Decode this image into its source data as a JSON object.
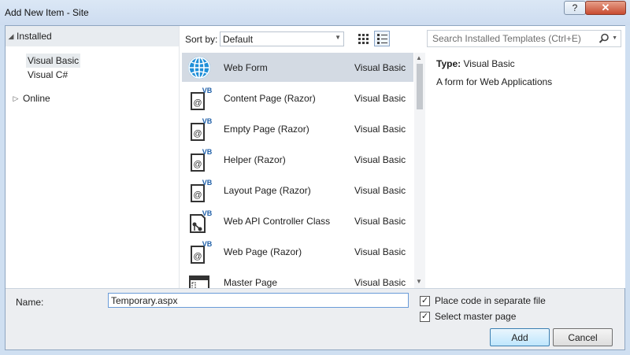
{
  "window": {
    "title": "Add New Item - Site",
    "help_glyph": "?",
    "close_glyph": "✕"
  },
  "tree": {
    "installed_label": "Installed",
    "children": [
      {
        "label": "Visual Basic",
        "selected": true
      },
      {
        "label": "Visual C#",
        "selected": false
      }
    ],
    "online_label": "Online"
  },
  "toolbar": {
    "sort_label": "Sort by:",
    "sort_value": "Default"
  },
  "templates": [
    {
      "name": "Web Form",
      "language": "Visual Basic",
      "icon": "globe-icon",
      "selected": true
    },
    {
      "name": "Content Page (Razor)",
      "language": "Visual Basic",
      "icon": "vb-razor-page-icon"
    },
    {
      "name": "Empty Page (Razor)",
      "language": "Visual Basic",
      "icon": "vb-razor-page-icon"
    },
    {
      "name": "Helper (Razor)",
      "language": "Visual Basic",
      "icon": "vb-razor-page-icon"
    },
    {
      "name": "Layout Page (Razor)",
      "language": "Visual Basic",
      "icon": "vb-razor-page-icon"
    },
    {
      "name": "Web API Controller Class",
      "language": "Visual Basic",
      "icon": "vb-controller-class-icon"
    },
    {
      "name": "Web Page (Razor)",
      "language": "Visual Basic",
      "icon": "vb-razor-page-icon"
    },
    {
      "name": "Master Page",
      "language": "Visual Basic",
      "icon": "master-page-icon"
    }
  ],
  "vb_badge": "VB",
  "razor_glyph": "@",
  "search": {
    "placeholder": "Search Installed Templates (Ctrl+E)"
  },
  "details": {
    "type_key": "Type:",
    "type_value": "Visual Basic",
    "description": "A form for Web Applications"
  },
  "footer": {
    "name_label": "Name:",
    "name_value": "Temporary.aspx",
    "checkbox_separate_label": "Place code in separate file",
    "checkbox_separate_checked": true,
    "checkbox_master_label": "Select master page",
    "checkbox_master_checked": true,
    "check_glyph": "✓",
    "add_label": "Add",
    "cancel_label": "Cancel"
  }
}
